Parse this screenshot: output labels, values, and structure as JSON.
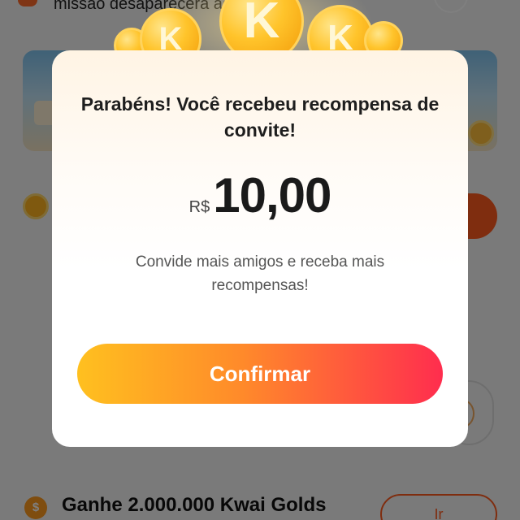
{
  "background": {
    "top_text": "missão desaparecerá ao acessar",
    "task_icon": "dollar-coin-icon",
    "task_icon_glyph": "$",
    "task_title": "Ganhe 2.000.000 Kwai Golds",
    "task_button_label": "Ir"
  },
  "decoration": {
    "coin_letter": "K"
  },
  "modal": {
    "title": "Parabéns! Você recebeu recompensa de convite!",
    "currency": "R$",
    "amount": "10,00",
    "subtext": "Convide mais amigos e receba mais recompensas!",
    "confirm_label": "Confirmar"
  },
  "colors": {
    "accent_start": "#ffc01f",
    "accent_end": "#ff2d4e",
    "overlay": "rgba(0,0,0,0.5)"
  }
}
